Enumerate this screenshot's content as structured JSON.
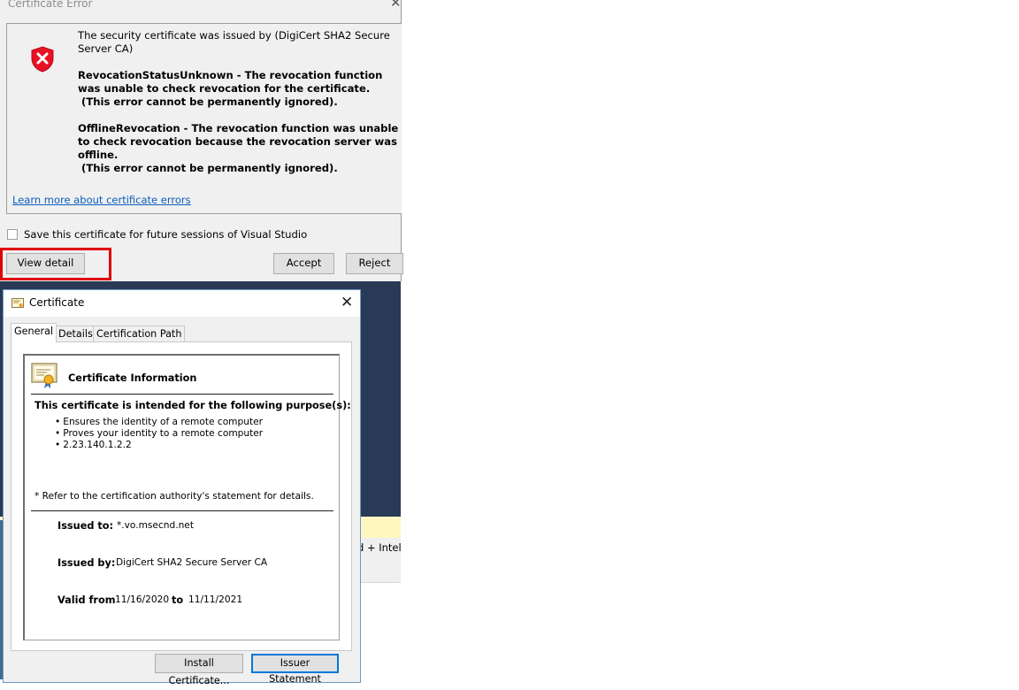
{
  "cert_error_dialog": {
    "title": "Certificate Error",
    "close_glyph": "✕",
    "message_issuer": "The security certificate was issued by (DigiCert SHA2 Secure Server CA)",
    "error1_line": "RevocationStatusUnknown - The revocation function was unable to check revocation for the certificate.",
    "error1_note": "(This error cannot be permanently ignored).",
    "error2_line": "OfflineRevocation - The revocation function was unable to check revocation because the revocation server was offline.",
    "error2_note": "(This error cannot be permanently ignored).",
    "learn_more_link": "Learn more about certificate errors",
    "save_checkbox_label": "Save this certificate for future sessions of Visual Studio",
    "save_checked": false,
    "view_detail_button": "View detail",
    "accept_button": "Accept",
    "reject_button": "Reject",
    "highlight_color": "#e00000",
    "icon": "shield-error-icon"
  },
  "certificate_dialog": {
    "title": "Certificate",
    "close_glyph": "✕",
    "tabs": [
      {
        "label": "General",
        "active": true
      },
      {
        "label": "Details",
        "active": false
      },
      {
        "label": "Certification Path",
        "active": false
      }
    ],
    "info_title": "Certificate Information",
    "purpose_heading": "This certificate is intended for the following purpose(s):",
    "purposes": [
      "Ensures the identity of a remote computer",
      "Proves your identity to a remote computer",
      "2.23.140.1.2.2"
    ],
    "refer_note": "* Refer to the certification authority's statement for details.",
    "issued_to_label": "Issued to:",
    "issued_to_value": "*.vo.msecnd.net",
    "issued_by_label": "Issued by:",
    "issued_by_value": "DigiCert SHA2 Secure Server CA",
    "valid_from_label": "Valid from",
    "valid_from_value": "11/16/2020",
    "valid_to_label": "to",
    "valid_to_value": "11/11/2021",
    "install_button": "Install Certificate...",
    "issuer_button": "Issuer Statement",
    "icon": "certificate-icon"
  },
  "background": {
    "fragment_text": "d + Intel",
    "navy_color": "#283a55"
  }
}
